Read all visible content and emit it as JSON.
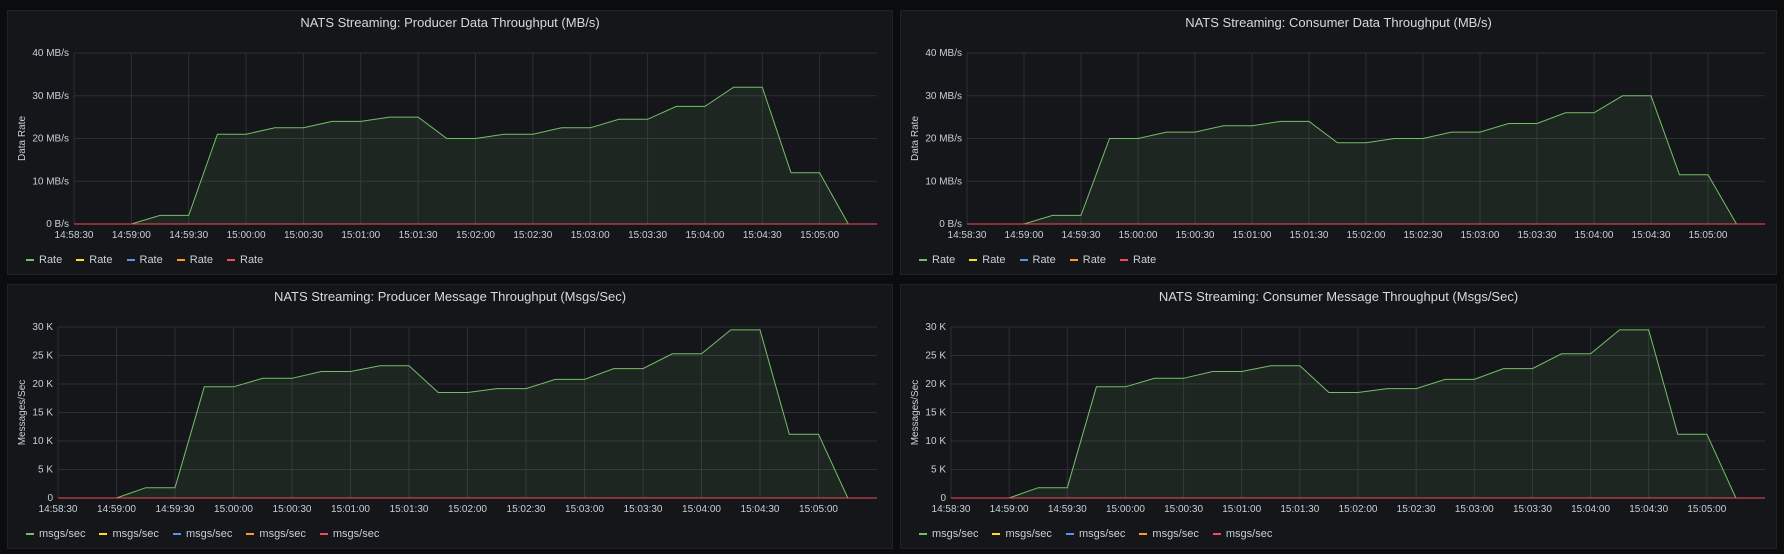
{
  "colors": {
    "green": "#73bf69",
    "yellow": "#fade2a",
    "blue": "#5794f2",
    "orange": "#ff9830",
    "red": "#f2495c"
  },
  "chart_data": [
    {
      "type": "area",
      "title": "NATS Streaming: Producer Data Throughput (MB/s)",
      "ylabel": "Data Rate",
      "ylim": [
        0,
        40
      ],
      "yticks": [
        0,
        10,
        20,
        30,
        40
      ],
      "ytick_labels": [
        "0 B/s",
        "10 MB/s",
        "20 MB/s",
        "30 MB/s",
        "40 MB/s"
      ],
      "x_ticks": [
        "14:58:30",
        "14:59:00",
        "14:59:30",
        "15:00:00",
        "15:00:30",
        "15:01:00",
        "15:01:30",
        "15:02:00",
        "15:02:30",
        "15:03:00",
        "15:03:30",
        "15:04:00",
        "15:04:30",
        "15:05:00"
      ],
      "x_tick_seconds": [
        -90,
        -60,
        -30,
        0,
        30,
        60,
        90,
        120,
        150,
        180,
        210,
        240,
        270,
        300
      ],
      "xlim_seconds": [
        -90,
        330
      ],
      "series": [
        {
          "name": "Rate",
          "color": "green",
          "x": [
            -90,
            -60,
            -45,
            -30,
            -15,
            0,
            15,
            30,
            45,
            60,
            75,
            90,
            105,
            120,
            135,
            150,
            165,
            180,
            195,
            210,
            225,
            240,
            255,
            270,
            285,
            300,
            315
          ],
          "y": [
            0,
            0,
            2,
            2,
            21,
            21,
            22.5,
            22.5,
            24,
            24,
            25,
            25,
            20,
            20,
            21,
            21,
            22.5,
            22.5,
            24.5,
            24.5,
            27.5,
            27.5,
            32,
            32,
            12,
            12,
            0
          ]
        },
        {
          "name": "Rate",
          "color": "yellow",
          "x": [
            -90,
            315
          ],
          "y": [
            0,
            0
          ]
        },
        {
          "name": "Rate",
          "color": "blue",
          "x": [
            -90,
            315
          ],
          "y": [
            0,
            0
          ]
        },
        {
          "name": "Rate",
          "color": "orange",
          "x": [
            -90,
            315
          ],
          "y": [
            0,
            0
          ]
        },
        {
          "name": "Rate",
          "color": "red",
          "x": [
            -90,
            330
          ],
          "y": [
            0,
            0
          ]
        }
      ]
    },
    {
      "type": "area",
      "title": "NATS Streaming: Consumer Data Throughput (MB/s)",
      "ylabel": "Data Rate",
      "ylim": [
        0,
        40
      ],
      "yticks": [
        0,
        10,
        20,
        30,
        40
      ],
      "ytick_labels": [
        "0 B/s",
        "10 MB/s",
        "20 MB/s",
        "30 MB/s",
        "40 MB/s"
      ],
      "x_ticks": [
        "14:58:30",
        "14:59:00",
        "14:59:30",
        "15:00:00",
        "15:00:30",
        "15:01:00",
        "15:01:30",
        "15:02:00",
        "15:02:30",
        "15:03:00",
        "15:03:30",
        "15:04:00",
        "15:04:30",
        "15:05:00"
      ],
      "x_tick_seconds": [
        -90,
        -60,
        -30,
        0,
        30,
        60,
        90,
        120,
        150,
        180,
        210,
        240,
        270,
        300
      ],
      "xlim_seconds": [
        -90,
        330
      ],
      "series": [
        {
          "name": "Rate",
          "color": "green",
          "x": [
            -90,
            -60,
            -45,
            -30,
            -15,
            0,
            15,
            30,
            45,
            60,
            75,
            90,
            105,
            120,
            135,
            150,
            165,
            180,
            195,
            210,
            225,
            240,
            255,
            270,
            285,
            300,
            315
          ],
          "y": [
            0,
            0,
            2,
            2,
            20,
            20,
            21.5,
            21.5,
            23,
            23,
            24,
            24,
            19,
            19,
            20,
            20,
            21.5,
            21.5,
            23.5,
            23.5,
            26,
            26,
            30,
            30,
            11.5,
            11.5,
            0
          ]
        },
        {
          "name": "Rate",
          "color": "yellow",
          "x": [
            -90,
            315
          ],
          "y": [
            0,
            0
          ]
        },
        {
          "name": "Rate",
          "color": "blue",
          "x": [
            -90,
            315
          ],
          "y": [
            0,
            0
          ]
        },
        {
          "name": "Rate",
          "color": "orange",
          "x": [
            -90,
            315
          ],
          "y": [
            0,
            0
          ]
        },
        {
          "name": "Rate",
          "color": "red",
          "x": [
            -90,
            330
          ],
          "y": [
            0,
            0
          ]
        }
      ]
    },
    {
      "type": "area",
      "title": "NATS Streaming: Producer Message Throughput (Msgs/Sec)",
      "ylabel": "Messages/Sec",
      "ylim": [
        0,
        30000
      ],
      "yticks": [
        0,
        5000,
        10000,
        15000,
        20000,
        25000,
        30000
      ],
      "ytick_labels": [
        "0",
        "5 K",
        "10 K",
        "15 K",
        "20 K",
        "25 K",
        "30 K"
      ],
      "x_ticks": [
        "14:58:30",
        "14:59:00",
        "14:59:30",
        "15:00:00",
        "15:00:30",
        "15:01:00",
        "15:01:30",
        "15:02:00",
        "15:02:30",
        "15:03:00",
        "15:03:30",
        "15:04:00",
        "15:04:30",
        "15:05:00"
      ],
      "x_tick_seconds": [
        -90,
        -60,
        -30,
        0,
        30,
        60,
        90,
        120,
        150,
        180,
        210,
        240,
        270,
        300
      ],
      "xlim_seconds": [
        -90,
        330
      ],
      "series": [
        {
          "name": "msgs/sec",
          "color": "green",
          "x": [
            -90,
            -60,
            -45,
            -30,
            -15,
            0,
            15,
            30,
            45,
            60,
            75,
            90,
            105,
            120,
            135,
            150,
            165,
            180,
            195,
            210,
            225,
            240,
            255,
            270,
            285,
            300,
            315
          ],
          "y": [
            0,
            0,
            1800,
            1800,
            19500,
            19500,
            21000,
            21000,
            22200,
            22200,
            23200,
            23200,
            18500,
            18500,
            19200,
            19200,
            20800,
            20800,
            22700,
            22700,
            25300,
            25300,
            29500,
            29500,
            11200,
            11200,
            0
          ]
        },
        {
          "name": "msgs/sec",
          "color": "yellow",
          "x": [
            -90,
            315
          ],
          "y": [
            0,
            0
          ]
        },
        {
          "name": "msgs/sec",
          "color": "blue",
          "x": [
            -90,
            315
          ],
          "y": [
            0,
            0
          ]
        },
        {
          "name": "msgs/sec",
          "color": "orange",
          "x": [
            -90,
            315
          ],
          "y": [
            0,
            0
          ]
        },
        {
          "name": "msgs/sec",
          "color": "red",
          "x": [
            -90,
            330
          ],
          "y": [
            0,
            0
          ]
        }
      ]
    },
    {
      "type": "area",
      "title": "NATS Streaming: Consumer Message Throughput (Msgs/Sec)",
      "ylabel": "Messages/Sec",
      "ylim": [
        0,
        30000
      ],
      "yticks": [
        0,
        5000,
        10000,
        15000,
        20000,
        25000,
        30000
      ],
      "ytick_labels": [
        "0",
        "5 K",
        "10 K",
        "15 K",
        "20 K",
        "25 K",
        "30 K"
      ],
      "x_ticks": [
        "14:58:30",
        "14:59:00",
        "14:59:30",
        "15:00:00",
        "15:00:30",
        "15:01:00",
        "15:01:30",
        "15:02:00",
        "15:02:30",
        "15:03:00",
        "15:03:30",
        "15:04:00",
        "15:04:30",
        "15:05:00"
      ],
      "x_tick_seconds": [
        -90,
        -60,
        -30,
        0,
        30,
        60,
        90,
        120,
        150,
        180,
        210,
        240,
        270,
        300
      ],
      "xlim_seconds": [
        -90,
        330
      ],
      "series": [
        {
          "name": "msgs/sec",
          "color": "green",
          "x": [
            -90,
            -60,
            -45,
            -30,
            -15,
            0,
            15,
            30,
            45,
            60,
            75,
            90,
            105,
            120,
            135,
            150,
            165,
            180,
            195,
            210,
            225,
            240,
            255,
            270,
            285,
            300,
            315
          ],
          "y": [
            0,
            0,
            1800,
            1800,
            19500,
            19500,
            21000,
            21000,
            22200,
            22200,
            23200,
            23200,
            18500,
            18500,
            19200,
            19200,
            20800,
            20800,
            22700,
            22700,
            25300,
            25300,
            29500,
            29500,
            11200,
            11200,
            0
          ]
        },
        {
          "name": "msgs/sec",
          "color": "yellow",
          "x": [
            -90,
            315
          ],
          "y": [
            0,
            0
          ]
        },
        {
          "name": "msgs/sec",
          "color": "blue",
          "x": [
            -90,
            315
          ],
          "y": [
            0,
            0
          ]
        },
        {
          "name": "msgs/sec",
          "color": "orange",
          "x": [
            -90,
            315
          ],
          "y": [
            0,
            0
          ]
        },
        {
          "name": "msgs/sec",
          "color": "red",
          "x": [
            -90,
            330
          ],
          "y": [
            0,
            0
          ]
        }
      ]
    }
  ]
}
